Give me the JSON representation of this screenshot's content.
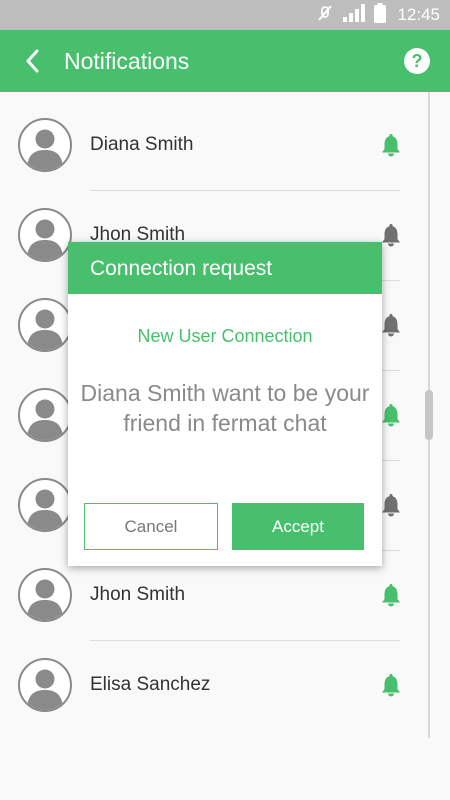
{
  "status_bar": {
    "time": "12:45",
    "icons": [
      "mute-icon",
      "signal-icon",
      "battery-icon"
    ]
  },
  "app_bar": {
    "title": "Notifications",
    "back_icon": "chevron-left-icon",
    "help_label": "?"
  },
  "notifications": [
    {
      "name": "Diana Smith",
      "bell_color": "#48bf6c"
    },
    {
      "name": "Jhon Smith",
      "bell_color": "#707070"
    },
    {
      "name": "",
      "bell_color": "#707070"
    },
    {
      "name": "",
      "bell_color": "#48bf6c"
    },
    {
      "name": "",
      "bell_color": "#707070"
    },
    {
      "name": "Jhon Smith",
      "bell_color": "#48bf6c"
    },
    {
      "name": "Elisa Sanchez",
      "bell_color": "#48bf6c"
    }
  ],
  "dialog": {
    "title": "Connection request",
    "subtitle": "New User Connection",
    "message": "Diana Smith want to be your friend in fermat chat",
    "cancel_label": "Cancel",
    "accept_label": "Accept"
  },
  "colors": {
    "accent": "#48bf6c",
    "status_bar": "#bdbdbd",
    "bell_inactive": "#707070"
  }
}
